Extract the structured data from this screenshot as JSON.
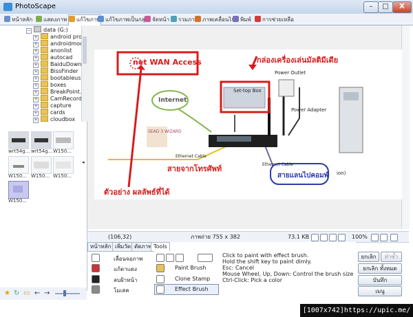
{
  "window": {
    "title": "PhotoScape",
    "minimize": "–",
    "maximize": "□",
    "close": "X"
  },
  "tabs": [
    {
      "label": "หน้าหลัก",
      "color": "#6b8fc8"
    },
    {
      "label": "แสดงภาพ",
      "color": "#7cae4f"
    },
    {
      "label": "แก้ไขภาพ",
      "color": "#e59a2c"
    },
    {
      "label": "แก้ไขภาพเป็นกลุ่ม",
      "color": "#5a8fd1"
    },
    {
      "label": "จัดหน้า",
      "color": "#c85a9a"
    },
    {
      "label": "รวมภาพ",
      "color": "#4fa0b8"
    },
    {
      "label": "ภาพเคลื่อนไหว",
      "color": "#d1732d"
    },
    {
      "label": "พิมพ์",
      "color": "#7a6fb8"
    },
    {
      "label": "การช่วยเหลือ",
      "color": "#d23b3b"
    }
  ],
  "tree": {
    "root": "data (G:)",
    "items": [
      "android proc",
      "androidmod",
      "anonlist",
      "autocad",
      "BaiduDownl",
      "BissFinder",
      "bootableust",
      "boxes",
      "BreakPoint.I",
      "CamRecorde",
      "capture",
      "cards",
      "cloudbox"
    ]
  },
  "thumbnails": [
    "wrt54g...",
    "wrt54g...",
    "W150...",
    "W150...",
    "W150...",
    "W150...",
    "W150..."
  ],
  "image": {
    "wan_title": "net WAN Access",
    "callout_player": "กล่องเครื่องเล่นมัลติมีเดีย",
    "power_outlet": "Power Outlet",
    "set_top_box": "Set-top Box",
    "internet": "Internet",
    "power_adapter": "Power Adapter",
    "ethernet_cable_1": "Ethernet Cable",
    "ethernet_cable_2": "Ethernet Cable",
    "phone_line": "สายจากโทรศัพท์",
    "lan_to_pc": "สายแลนไปคอมพ์",
    "example": "ตัวอย่าง ผลลัพธ์ที่ได้",
    "section": "ion)",
    "watermark": "SEAD 3 WIZARD"
  },
  "status": {
    "coords": "(106,32)",
    "size": "ภาพถ่าย 755 x 382",
    "filesize": "73.1 KB",
    "zoom": "100%"
  },
  "tools_panel": {
    "tabs": [
      "หน้าหลัก",
      "เพิ่มวัตถุ",
      "ตัดภาพ",
      "Tools"
    ],
    "left_items": [
      "เลื่อนจอภาพ",
      "แก้ตาแดง",
      "ลบฝ้าหน้า",
      "โมเสค"
    ],
    "brush_items": [
      "Paint Brush",
      "Clone Stamp",
      "Effect Brush"
    ],
    "help_lines": [
      "Click to paint with effect brush.",
      "Hold the shift key to paint dimly.",
      "Esc: Cancel",
      "Mouse Wheel, Up, Down: Control the brush size",
      "Ctrl-Click: Pick a color"
    ]
  },
  "right_buttons": {
    "undo": "ยกเลิก",
    "redo": "ทำซ้ำ",
    "undo_all": "ยกเลิก ทั้งหมด",
    "save": "บันทึก",
    "menu": "เมนู"
  },
  "footer": {
    "text": "[1007x742]https://upic.me/"
  }
}
